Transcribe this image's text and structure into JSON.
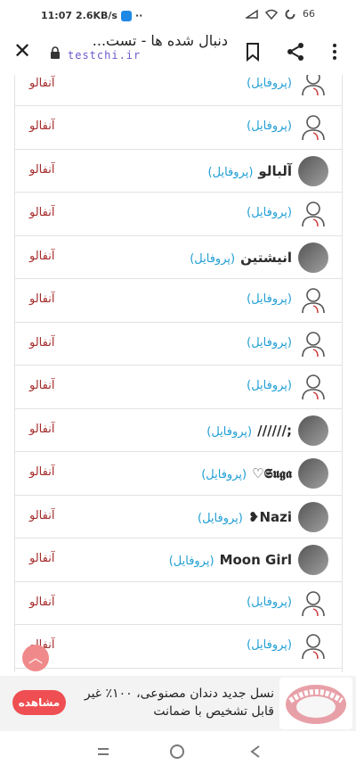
{
  "status": {
    "time": "11:07",
    "speed": "2.6KB/s",
    "dots": "··",
    "battery": "66"
  },
  "toolbar": {
    "title": "دنبال شده ها - تست...",
    "url": "testchi.ir"
  },
  "rows": [
    {
      "username": "",
      "profile": "(پروفایل)",
      "action": "آنفالو",
      "avatar": "person"
    },
    {
      "username": "",
      "profile": "(پروفایل)",
      "action": "آنفالو",
      "avatar": "person"
    },
    {
      "username": "آلبالو",
      "profile": "(پروفایل)",
      "action": "آنفالو",
      "avatar": "photo"
    },
    {
      "username": "",
      "profile": "(پروفایل)",
      "action": "آنفالو",
      "avatar": "person"
    },
    {
      "username": "انیشتین",
      "profile": "(پروفایل)",
      "action": "آنفالو",
      "avatar": "photo"
    },
    {
      "username": "",
      "profile": "(پروفایل)",
      "action": "آنفالو",
      "avatar": "person"
    },
    {
      "username": "",
      "profile": "(پروفایل)",
      "action": "آنفالو",
      "avatar": "person"
    },
    {
      "username": "",
      "profile": "(پروفایل)",
      "action": "آنفالو",
      "avatar": "person"
    },
    {
      "username": "//////;",
      "profile": "(پروفایل)",
      "action": "آنفالو",
      "avatar": "photo"
    },
    {
      "username": "♡𝕾𝖚𝖌𝖆",
      "profile": "(پروفایل)",
      "action": "آنفالو",
      "avatar": "photo"
    },
    {
      "username": "❥Nazi",
      "profile": "(پروفایل)",
      "action": "آنفالو",
      "avatar": "photo"
    },
    {
      "username": "Moon Girl",
      "profile": "(پروفایل)",
      "action": "آنفالو",
      "avatar": "photo"
    },
    {
      "username": "",
      "profile": "(پروفایل)",
      "action": "آنفالو",
      "avatar": "person"
    },
    {
      "username": "",
      "profile": "(پروفایل)",
      "action": "آنفالو",
      "avatar": "person"
    }
  ],
  "ad": {
    "text": "نسل جدید دندان مصنوعی، ۱۰۰٪ غیر قابل تشخیص با ضمانت",
    "button": "مشاهده"
  },
  "colors": {
    "link": "#1f9ed4",
    "unfollow": "#a52a2a",
    "ad_button": "#ef4f52",
    "fab": "#f08a8a"
  },
  "icons": {
    "close": "close-icon",
    "lock": "lock-icon",
    "bookmark": "bookmark-icon",
    "share": "share-icon",
    "menu": "more-vertical-icon",
    "fab": "chevron-up-icon"
  }
}
